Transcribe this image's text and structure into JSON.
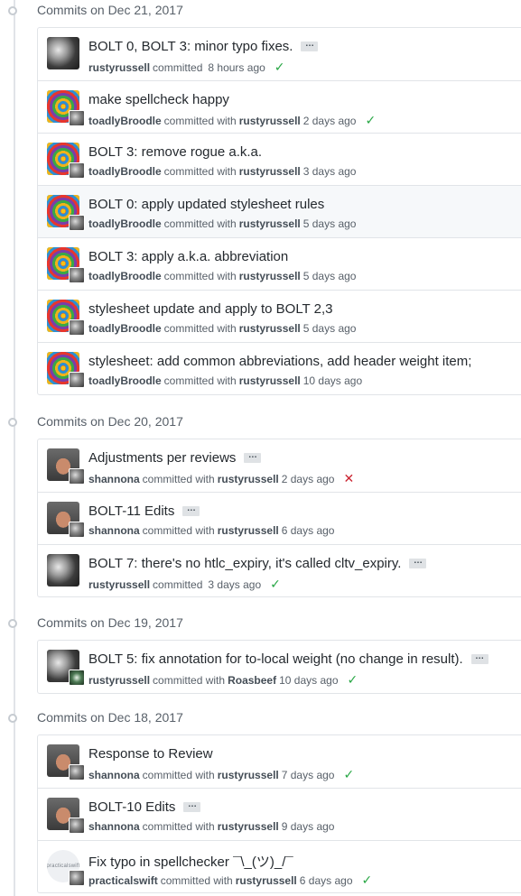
{
  "groups": [
    {
      "title": "Commits on Dec 21, 2017",
      "commits": [
        {
          "message": "BOLT 0, BOLT 3: minor typo fixes.",
          "has_ellipsis": true,
          "author": "rustyrussell",
          "committer": "",
          "time": "8 hours ago",
          "status": "success",
          "avatar": "grey-avatar"
        },
        {
          "message": "make spellcheck happy",
          "has_ellipsis": false,
          "author": "toadlyBroodle",
          "committer": "rustyrussell",
          "time": "2 days ago",
          "status": "success",
          "avatar": "spiral-avatar"
        },
        {
          "message": "BOLT 3: remove rogue a.k.a.",
          "has_ellipsis": false,
          "author": "toadlyBroodle",
          "committer": "rustyrussell",
          "time": "3 days ago",
          "status": "",
          "avatar": "spiral-avatar"
        },
        {
          "message": "BOLT 0: apply updated stylesheet rules",
          "has_ellipsis": false,
          "author": "toadlyBroodle",
          "committer": "rustyrussell",
          "time": "5 days ago",
          "status": "",
          "avatar": "spiral-avatar",
          "highlight": true
        },
        {
          "message": "BOLT 3: apply a.k.a. abbreviation",
          "has_ellipsis": false,
          "author": "toadlyBroodle",
          "committer": "rustyrussell",
          "time": "5 days ago",
          "status": "",
          "avatar": "spiral-avatar"
        },
        {
          "message": "stylesheet update and apply to BOLT 2,3",
          "has_ellipsis": false,
          "author": "toadlyBroodle",
          "committer": "rustyrussell",
          "time": "5 days ago",
          "status": "",
          "avatar": "spiral-avatar"
        },
        {
          "message": "stylesheet: add common abbreviations, add header weight item;",
          "has_ellipsis": false,
          "author": "toadlyBroodle",
          "committer": "rustyrussell",
          "time": "10 days ago",
          "status": "",
          "avatar": "spiral-avatar"
        }
      ]
    },
    {
      "title": "Commits on Dec 20, 2017",
      "commits": [
        {
          "message": "Adjustments per reviews",
          "has_ellipsis": true,
          "author": "shannona",
          "committer": "rustyrussell",
          "time": "2 days ago",
          "status": "failure",
          "avatar": "person-avatar"
        },
        {
          "message": "BOLT-11 Edits",
          "has_ellipsis": true,
          "author": "shannona",
          "committer": "rustyrussell",
          "time": "6 days ago",
          "status": "",
          "avatar": "person-avatar"
        },
        {
          "message": "BOLT 7: there's no htlc_expiry, it's called cltv_expiry.",
          "has_ellipsis": true,
          "author": "rustyrussell",
          "committer": "",
          "time": "3 days ago",
          "status": "success",
          "avatar": "grey-avatar"
        }
      ]
    },
    {
      "title": "Commits on Dec 19, 2017",
      "commits": [
        {
          "message": "BOLT 5: fix annotation for to-local weight (no change in result).",
          "has_ellipsis": true,
          "author": "rustyrussell",
          "committer": "Roasbeef",
          "time": "10 days ago",
          "status": "success",
          "avatar": "grey-avatar",
          "sub_avatar": "green"
        }
      ]
    },
    {
      "title": "Commits on Dec 18, 2017",
      "commits": [
        {
          "message": "Response to Review",
          "has_ellipsis": false,
          "author": "shannona",
          "committer": "rustyrussell",
          "time": "7 days ago",
          "status": "success",
          "avatar": "person-avatar"
        },
        {
          "message": "BOLT-10 Edits",
          "has_ellipsis": true,
          "author": "shannona",
          "committer": "rustyrussell",
          "time": "9 days ago",
          "status": "",
          "avatar": "person-avatar"
        },
        {
          "message": "Fix typo in spellchecker ¯\\_(ツ)_/¯",
          "has_ellipsis": false,
          "author": "practicalswift",
          "committer": "rustyrussell",
          "time": "6 days ago",
          "status": "success",
          "avatar": "logo-avatar",
          "logo_text": "practicalswift"
        }
      ]
    }
  ],
  "labels": {
    "committed": "committed",
    "committed_with": "committed with",
    "ellipsis": "…",
    "success_icon": "✓",
    "failure_icon": "✕"
  },
  "colors": {
    "success": "#28a745",
    "failure": "#cb2431",
    "border": "#e1e4e8",
    "highlight_row": "#f6f8fa"
  }
}
